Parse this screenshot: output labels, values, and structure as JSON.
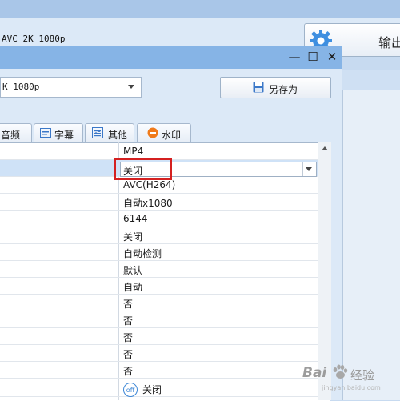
{
  "background": {
    "preset_label": "AVC 2K 1080p",
    "export_button": {
      "label": "输出",
      "icon": "gear-icon"
    }
  },
  "dialog": {
    "window_controls": {
      "minimize": "—",
      "maximize": "☐",
      "close": "✕"
    },
    "preset_value": "K 1080p",
    "save_as_label": "另存为",
    "tabs": [
      {
        "label": "音频",
        "icon": "audio-icon"
      },
      {
        "label": "字幕",
        "icon": "subtitle-icon"
      },
      {
        "label": "其他",
        "icon": "settings-icon"
      },
      {
        "label": "水印",
        "icon": "watermark-icon"
      }
    ],
    "table": {
      "rows": [
        {
          "value": "MP4"
        },
        {
          "value": "关闭",
          "editing": true
        },
        {
          "value": "AVC(H264)"
        },
        {
          "value": "自动x1080"
        },
        {
          "value": "6144"
        },
        {
          "value": "关闭"
        },
        {
          "value": "自动检测"
        },
        {
          "value": "默认"
        },
        {
          "value": "自动"
        },
        {
          "value": "否"
        },
        {
          "value": "否"
        },
        {
          "value": "否"
        },
        {
          "value": "否"
        },
        {
          "value": "否"
        },
        {
          "value": "关闭",
          "badge": "off"
        }
      ]
    }
  },
  "watermark": {
    "brand": "Bai",
    "text": "经验",
    "url": "jingyan.baidu.com"
  },
  "colors": {
    "highlight": "#d42020",
    "title_bar": "#86b4e6",
    "accent": "#3c86d6"
  }
}
